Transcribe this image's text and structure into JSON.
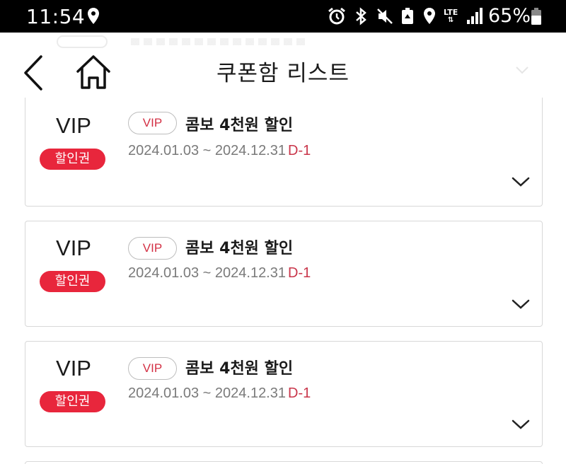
{
  "status_bar": {
    "time": "11:54",
    "battery_percent": "65%",
    "network": "LTE",
    "icons": [
      "location-icon",
      "alarm-icon",
      "bluetooth-icon",
      "mute-icon",
      "recycle-icon",
      "location-icon",
      "lte-icon",
      "signal-icon",
      "battery-icon"
    ]
  },
  "header": {
    "title": "쿠폰함 리스트",
    "back_icon": "chevron-left-icon",
    "home_icon": "home-icon"
  },
  "coupons": [
    {
      "tier": "VIP",
      "type_badge": "할인권",
      "tag": "VIP",
      "title": "콤보 4천원 할인",
      "period": "2024.01.03 ~ 2024.12.31",
      "dday": "D-1"
    },
    {
      "tier": "VIP",
      "type_badge": "할인권",
      "tag": "VIP",
      "title": "콤보 4천원 할인",
      "period": "2024.01.03 ~ 2024.12.31",
      "dday": "D-1"
    },
    {
      "tier": "VIP",
      "type_badge": "할인권",
      "tag": "VIP",
      "title": "콤보 4천원 할인",
      "period": "2024.01.03 ~ 2024.12.31",
      "dday": "D-1"
    }
  ],
  "colors": {
    "accent_red": "#e8263c",
    "dday_red": "#c9354a",
    "status_bar_bg": "#000000",
    "border": "#d8d8d8"
  }
}
